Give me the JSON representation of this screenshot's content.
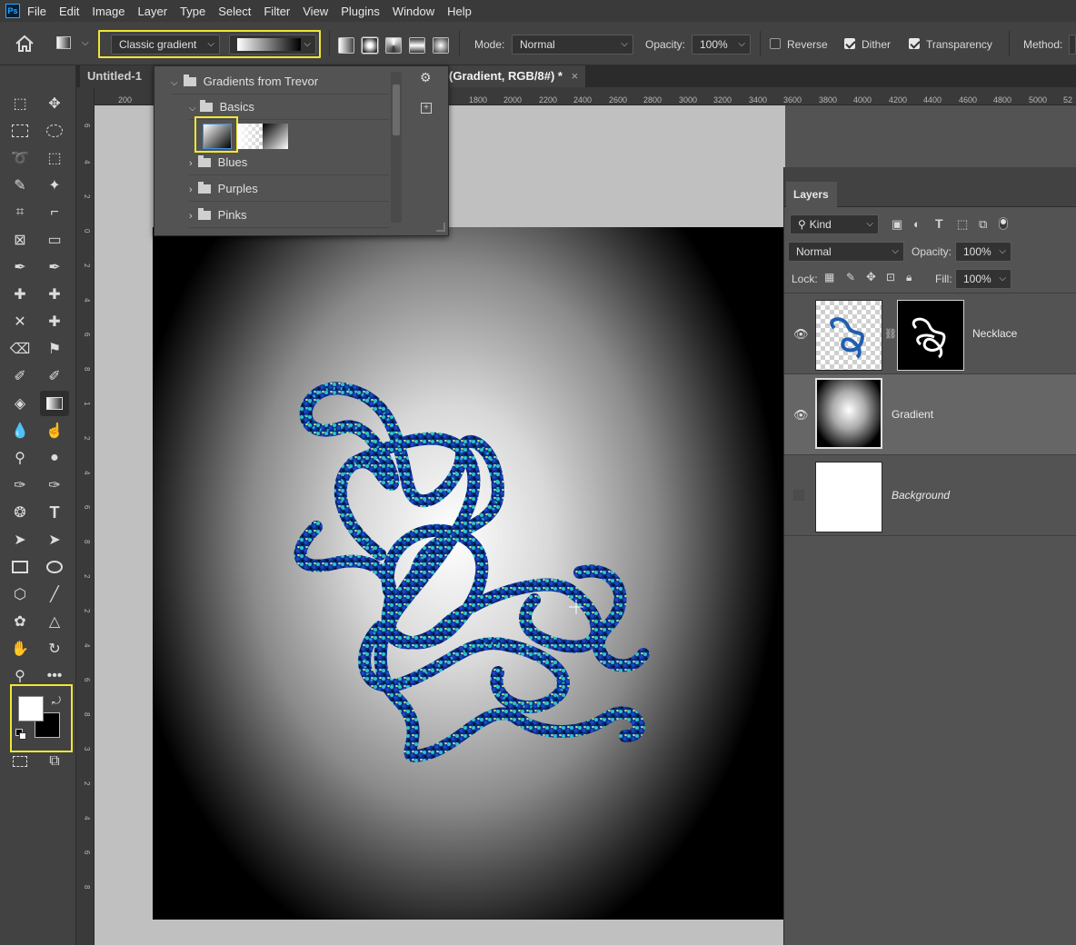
{
  "app": {
    "logo": "Ps"
  },
  "menu": [
    "File",
    "Edit",
    "Image",
    "Layer",
    "Type",
    "Select",
    "Filter",
    "View",
    "Plugins",
    "Window",
    "Help"
  ],
  "options": {
    "gradient_style": "Classic gradient",
    "mode_label": "Mode:",
    "mode_value": "Normal",
    "opacity_label": "Opacity:",
    "opacity_value": "100%",
    "reverse_label": "Reverse",
    "reverse_checked": false,
    "dither_label": "Dither",
    "dither_checked": true,
    "transparency_label": "Transparency",
    "transparency_checked": true,
    "method_label": "Method:"
  },
  "tabs": {
    "tab1": "Untitled-1 @",
    "tab2": "(Gradient, RGB/8#) *",
    "close": "×"
  },
  "ruler": {
    "h": [
      "200",
      "1800",
      "2000",
      "2200",
      "2400",
      "2600",
      "2800",
      "3000",
      "3200",
      "3400",
      "3600",
      "3800",
      "4000",
      "4200",
      "4400",
      "4600",
      "4800",
      "5000",
      "52"
    ],
    "v": [
      "6",
      "4",
      "2",
      "0",
      "2",
      "4",
      "6",
      "8",
      "1",
      "2",
      "4",
      "6",
      "8",
      "2",
      "2",
      "4",
      "6",
      "8",
      "3",
      "2",
      "4",
      "6",
      "8",
      "4",
      "2",
      "4",
      "6"
    ]
  },
  "picker": {
    "root_folder": "Gradients from Trevor",
    "subfolder": "Basics",
    "folders": [
      "Blues",
      "Purples",
      "Pinks"
    ]
  },
  "layers_panel": {
    "title": "Layers",
    "filter_kind": "Kind",
    "blend_mode": "Normal",
    "opacity_label": "Opacity:",
    "opacity_value": "100%",
    "lock_label": "Lock:",
    "fill_label": "Fill:",
    "fill_value": "100%",
    "layers": [
      {
        "name": "Necklace",
        "visible": true
      },
      {
        "name": "Gradient",
        "visible": true,
        "selected": true
      },
      {
        "name": "Background",
        "visible": false
      }
    ]
  },
  "colors": {
    "foreground": "#ffffff",
    "background": "#000000",
    "highlight": "#f0e634",
    "bead_dark": "#0b2d8a",
    "bead_light": "#2ec4c8"
  }
}
